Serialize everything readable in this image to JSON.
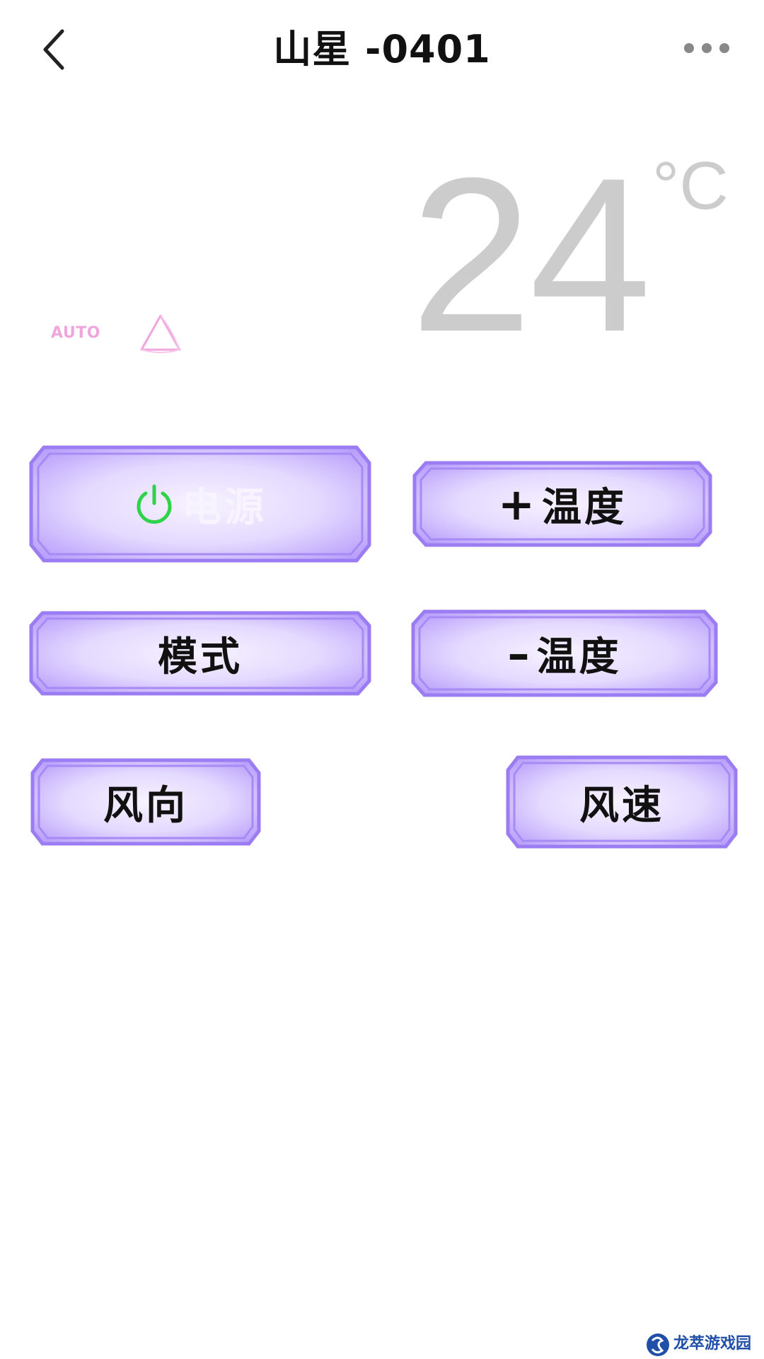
{
  "header": {
    "title": "山星 -0401",
    "back_icon": "chevron-left-icon",
    "more_icon": "more-horizontal-icon"
  },
  "display": {
    "temperature": "24",
    "unit": "°C",
    "mode_label": "AUTO",
    "fan_icon": "fan-speed-triangle-icon"
  },
  "buttons": {
    "power": {
      "label": "电源",
      "icon": "power-icon"
    },
    "temp_up": {
      "symbol": "+",
      "label": "温度"
    },
    "mode": {
      "label": "模式"
    },
    "temp_down": {
      "symbol": "–",
      "label": "温度"
    },
    "swing": {
      "label": "风向"
    },
    "speed": {
      "label": "风速"
    }
  },
  "watermark": {
    "text": "龙萃游戏园"
  },
  "colors": {
    "button_border": "#9b7cf2",
    "button_fill_center": "#f4efff",
    "button_fill_edge": "#c4aefc",
    "power_icon": "#2ed34a",
    "display_text": "#cccccc",
    "mode_label": "#f0a6dd"
  }
}
